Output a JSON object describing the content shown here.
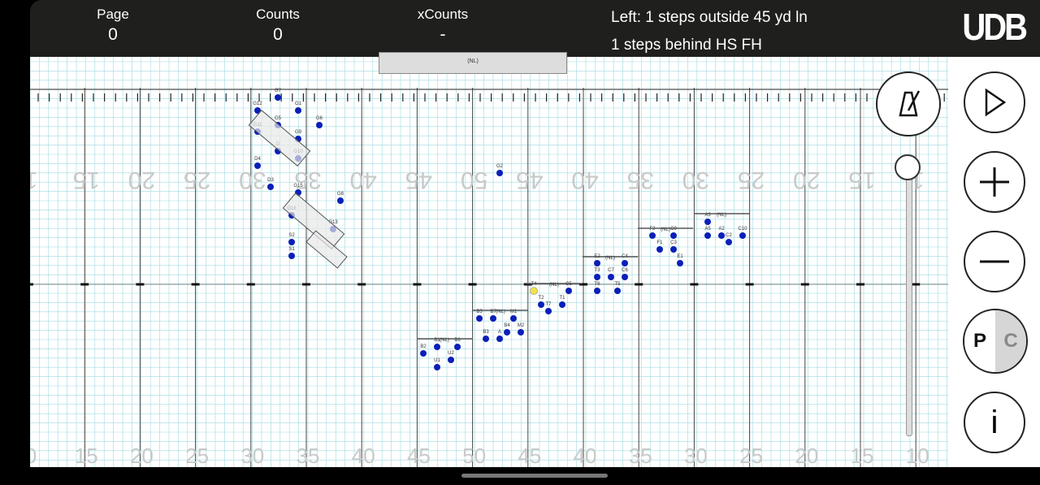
{
  "header": {
    "page_label": "Page",
    "page_value": "0",
    "counts_label": "Counts",
    "counts_value": "0",
    "xcounts_label": "xCounts",
    "xcounts_value": "-",
    "info_line1": "Left: 1 steps outside 45 yd ln",
    "info_line2": "1 steps behind HS FH",
    "logo": "UDB"
  },
  "field": {
    "top_numbers": [
      "1",
      "15",
      "20",
      "25",
      "30",
      "35",
      "40",
      "45",
      "50",
      "45",
      "40",
      "35",
      "30",
      "25",
      "20",
      "15",
      "1"
    ],
    "bottom_numbers": [
      "0",
      "15",
      "20",
      "25",
      "30",
      "35",
      "40",
      "45",
      "50",
      "45",
      "40",
      "35",
      "30",
      "25",
      "20",
      "15",
      "10"
    ],
    "nl_label": "(NL)",
    "marker_colors": {
      "dot": "#0a1fb8",
      "highlight": "#f2e14a",
      "grid": "#9fd9e0",
      "line": "#444444"
    }
  },
  "performers": [
    {
      "id": "G7",
      "dot": true
    },
    {
      "id": "G12",
      "dot": true
    },
    {
      "id": "G1",
      "dot": true
    },
    {
      "id": "G5",
      "dot": true
    },
    {
      "id": "G6",
      "dot": true
    },
    {
      "id": "G11",
      "dot": true
    },
    {
      "id": "G9",
      "dot": true
    },
    {
      "id": "D",
      "dot": true
    },
    {
      "id": "G10",
      "dot": true
    },
    {
      "id": "D4",
      "dot": true
    },
    {
      "id": "D3",
      "dot": true
    },
    {
      "id": "G15",
      "dot": true
    },
    {
      "id": "G8",
      "dot": true
    },
    {
      "id": "G16",
      "dot": true
    },
    {
      "id": "G13",
      "dot": true
    },
    {
      "id": "S2",
      "dot": true
    },
    {
      "id": "S1",
      "dot": true
    },
    {
      "id": "G2",
      "dot": true
    },
    {
      "id": "B2",
      "dot": true
    },
    {
      "id": "B1",
      "dot": true
    },
    {
      "id": "B6",
      "dot": true
    },
    {
      "id": "U1",
      "dot": true
    },
    {
      "id": "U2",
      "dot": true
    },
    {
      "id": "B5",
      "dot": true
    },
    {
      "id": "B7",
      "dot": true
    },
    {
      "id": "M1",
      "dot": true
    },
    {
      "id": "B3",
      "dot": true
    },
    {
      "id": "B4",
      "dot": true
    },
    {
      "id": "M2",
      "dot": true
    },
    {
      "id": "A",
      "dot": true
    },
    {
      "id": "T4",
      "dot": false
    },
    {
      "id": "T2",
      "dot": true
    },
    {
      "id": "T7",
      "dot": true
    },
    {
      "id": "T1",
      "dot": true
    },
    {
      "id": "C5",
      "dot": true
    },
    {
      "id": "E2",
      "dot": true
    },
    {
      "id": "C4",
      "dot": true
    },
    {
      "id": "T3",
      "dot": true
    },
    {
      "id": "C7",
      "dot": true
    },
    {
      "id": "C6",
      "dot": true
    },
    {
      "id": "T6",
      "dot": true
    },
    {
      "id": "T5",
      "dot": true
    },
    {
      "id": "F2",
      "dot": true
    },
    {
      "id": "C9",
      "dot": true
    },
    {
      "id": "F1",
      "dot": true
    },
    {
      "id": "C3",
      "dot": true
    },
    {
      "id": "E1",
      "dot": true
    },
    {
      "id": "A3",
      "dot": true
    },
    {
      "id": "A5",
      "dot": true
    },
    {
      "id": "A2",
      "dot": true
    },
    {
      "id": "C2",
      "dot": true
    },
    {
      "id": "C10",
      "dot": true
    }
  ],
  "controls": {
    "metronome_icon": "metronome-icon",
    "play_icon": "play-icon",
    "plus_icon": "plus-icon",
    "minus_icon": "minus-icon",
    "p_label": "P",
    "c_label": "C",
    "info_label": "i"
  }
}
